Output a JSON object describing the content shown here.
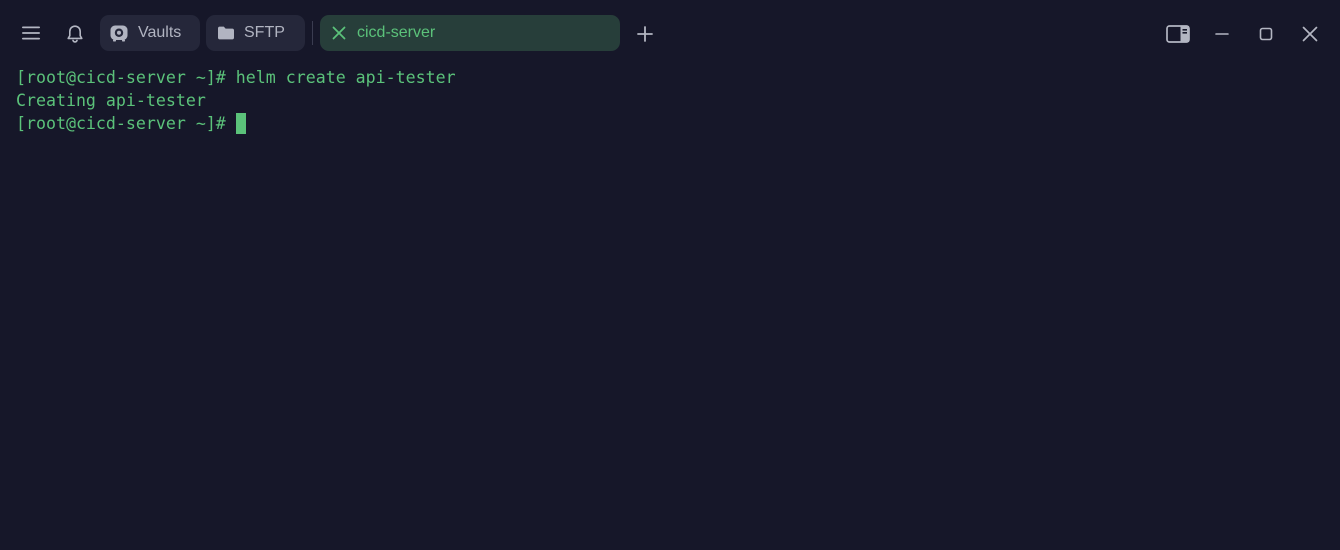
{
  "titlebar": {
    "menu_icon": "hamburger-menu-icon",
    "notifications_icon": "bell-icon",
    "tabs": [
      {
        "label": "Vaults",
        "icon": "vault-icon",
        "active": false
      },
      {
        "label": "SFTP",
        "icon": "folder-icon",
        "active": false
      },
      {
        "label": "cicd-server",
        "icon": "close-icon",
        "active": true
      }
    ],
    "new_tab_icon": "plus-icon",
    "window_controls": {
      "sidebar_toggle_icon": "sidebar-toggle-icon",
      "minimize_icon": "minimize-icon",
      "maximize_icon": "maximize-icon",
      "close_icon": "close-icon"
    }
  },
  "terminal": {
    "lines": [
      {
        "prompt": "[root@cicd-server ~]#",
        "command": " helm create api-tester"
      },
      {
        "output": "Creating api-tester"
      },
      {
        "prompt": "[root@cicd-server ~]#",
        "command": " "
      }
    ]
  },
  "colors": {
    "background": "#161729",
    "accent_green": "#5bc27a",
    "tab_background": "#25273a",
    "active_tab_background": "#273e3a"
  }
}
